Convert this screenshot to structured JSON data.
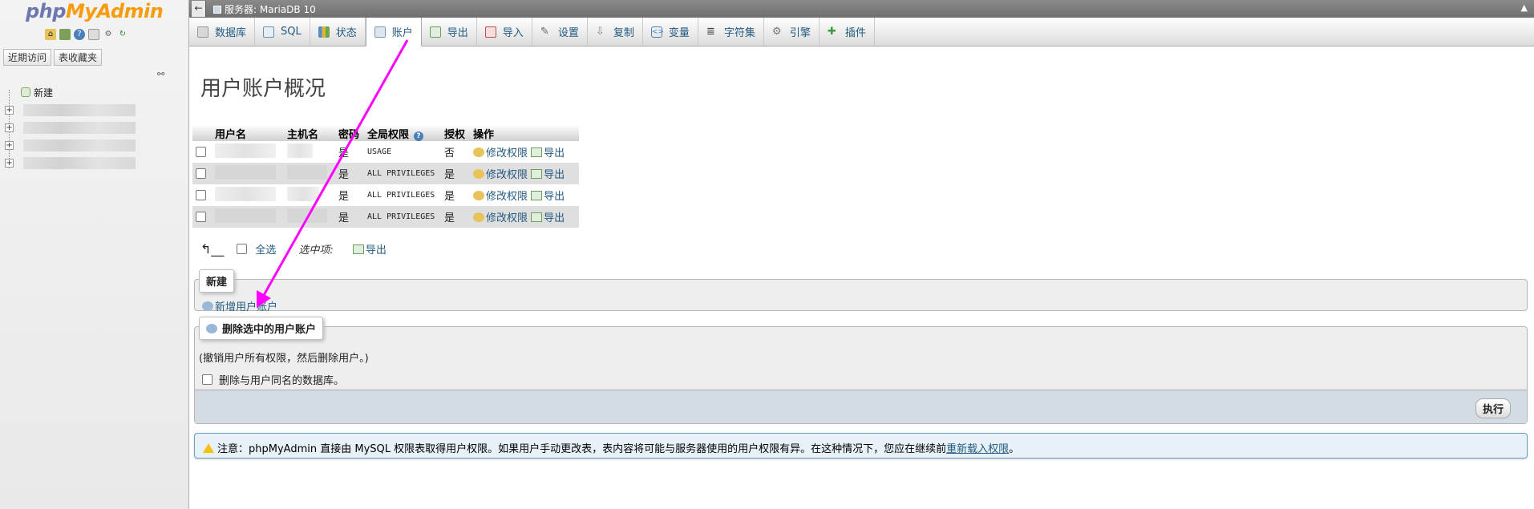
{
  "nav": {
    "logo_php": "php",
    "logo_myadmin": "MyAdmin",
    "tabs": [
      "近期访问",
      "表收藏夹"
    ],
    "new_label": "新建",
    "icons": [
      "home-icon",
      "logout-icon",
      "help-icon",
      "docs-icon",
      "settings-icon",
      "reload-icon"
    ]
  },
  "topbar": {
    "server": "服务器: MariaDB 10"
  },
  "menu": [
    {
      "label": "数据库",
      "icon": "database-icon"
    },
    {
      "label": "SQL",
      "icon": "sql-icon"
    },
    {
      "label": "状态",
      "icon": "status-icon"
    },
    {
      "label": "账户",
      "icon": "accounts-icon"
    },
    {
      "label": "导出",
      "icon": "export-icon"
    },
    {
      "label": "导入",
      "icon": "import-icon"
    },
    {
      "label": "设置",
      "icon": "settings-icon"
    },
    {
      "label": "复制",
      "icon": "replication-icon"
    },
    {
      "label": "变量",
      "icon": "variables-icon"
    },
    {
      "label": "字符集",
      "icon": "charset-icon"
    },
    {
      "label": "引擎",
      "icon": "engine-icon"
    },
    {
      "label": "插件",
      "icon": "plugin-icon"
    }
  ],
  "page": {
    "title": "用户账户概况"
  },
  "table": {
    "headers": [
      "用户名",
      "主机名",
      "密码",
      "全局权限",
      "授权",
      "操作"
    ],
    "rows": [
      {
        "password": "是",
        "privileges": "USAGE",
        "grant": "否",
        "edit": "修改权限",
        "export": "导出"
      },
      {
        "password": "是",
        "privileges": "ALL PRIVILEGES",
        "grant": "是",
        "edit": "修改权限",
        "export": "导出"
      },
      {
        "password": "是",
        "privileges": "ALL PRIVILEGES",
        "grant": "是",
        "edit": "修改权限",
        "export": "导出"
      },
      {
        "password": "是",
        "privileges": "ALL PRIVILEGES",
        "grant": "是",
        "edit": "修改权限",
        "export": "导出"
      }
    ]
  },
  "bulk": {
    "select_all": "全选",
    "with_selected": "选中项:",
    "export": "导出"
  },
  "new_section": {
    "legend": "新建",
    "add_user": "新增用户账户"
  },
  "delete_section": {
    "legend": "删除选中的用户账户",
    "description": "(撤销用户所有权限，然后删除用户。)",
    "drop_db_label": "删除与用户同名的数据库。",
    "go": "执行"
  },
  "notice": {
    "text": "注意：phpMyAdmin 直接由 MySQL 权限表取得用户权限。如果用户手动更改表，表内容将可能与服务器使用的用户权限有异。在这种情况下，您应在继续前",
    "link": "重新载入权限",
    "tail": "。"
  },
  "colors": {
    "link": "#235a81",
    "annotation_arrow": "#ff00ff",
    "logo_php": "#6c78af",
    "logo_myadmin": "#f89c0e"
  }
}
